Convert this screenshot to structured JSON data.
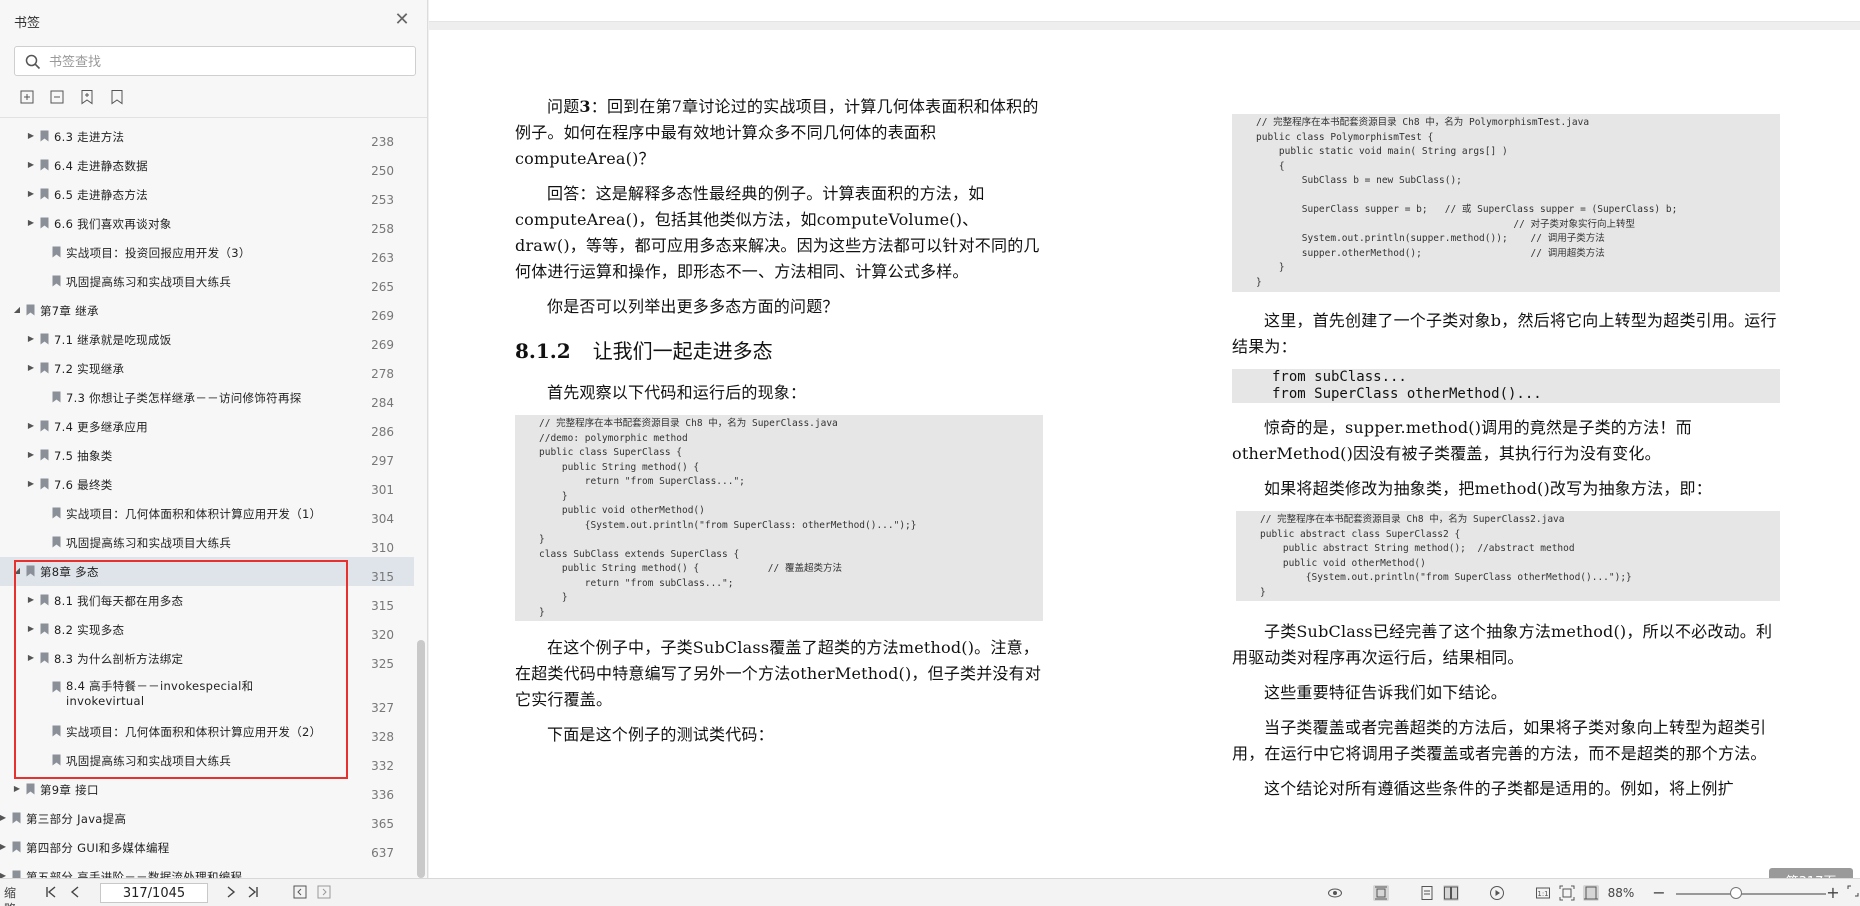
{
  "sidebar": {
    "title": "书签",
    "search_placeholder": "书签查找",
    "bookmarks": [
      {
        "label": "6.3  走进方法",
        "page": "238"
      },
      {
        "label": "6.4  走进静态数据",
        "page": "250"
      },
      {
        "label": "6.5  走进静态方法",
        "page": "253"
      },
      {
        "label": "6.6  我们喜欢再谈对象",
        "page": "258"
      },
      {
        "label": "实战项目：投资回报应用开发（3）",
        "page": "263"
      },
      {
        "label": "巩固提高练习和实战项目大练兵",
        "page": "265"
      },
      {
        "label": "第7章  继承",
        "page": "269"
      },
      {
        "label": "7.1  继承就是吃现成饭",
        "page": "269"
      },
      {
        "label": "7.2  实现继承",
        "page": "278"
      },
      {
        "label": "7.3  你想让子类怎样继承－－访问修饰符再探",
        "page": "284"
      },
      {
        "label": "7.4  更多继承应用",
        "page": "286"
      },
      {
        "label": "7.5  抽象类",
        "page": "297"
      },
      {
        "label": "7.6  最终类",
        "page": "301"
      },
      {
        "label": "实战项目：几何体面积和体积计算应用开发（1）",
        "page": "304"
      },
      {
        "label": "巩固提高练习和实战项目大练兵",
        "page": "310"
      },
      {
        "label": "第8章  多态",
        "page": "315"
      },
      {
        "label": "8.1  我们每天都在用多态",
        "page": "315"
      },
      {
        "label": "8.2  实现多态",
        "page": "320"
      },
      {
        "label": "8.3  为什么剖析方法绑定",
        "page": "325"
      },
      {
        "label": "8.4  高手特餐－－invokespecial和invokevirtual",
        "page": "327"
      },
      {
        "label": "实战项目：几何体面积和体积计算应用开发（2）",
        "page": "328"
      },
      {
        "label": "巩固提高练习和实战项目大练兵",
        "page": "332"
      },
      {
        "label": "第9章  接口",
        "page": "336"
      },
      {
        "label": "第三部分  Java提高",
        "page": "365"
      },
      {
        "label": "第四部分  GUI和多媒体编程",
        "page": "637"
      },
      {
        "label": "第五部分  高手进阶－－数据流处理和编程",
        "page": ""
      }
    ]
  },
  "document": {
    "left": {
      "p1_lead": "问题",
      "p1_num": "3",
      "p1_rest": "：回到在第7章讨论过的实战项目，计算几何体表面积和体积的例子。如何在程序中最有效地计算众多不同几何体的表面积computeArea()？",
      "p2": "回答：这是解释多态性最经典的例子。计算表面积的方法，如computeArea()，包括其他类似方法，如computeVolume()、draw()，等等，都可应用多态来解决。因为这些方法都可以针对不同的几何体进行运算和操作，即形态不一、方法相同、计算公式多样。",
      "p3": "你是否可以列举出更多多态方面的问题？",
      "h_num": "8.1.2",
      "h_title": "让我们一起走进多态",
      "p4": "首先观察以下代码和运行后的现象：",
      "code1": "// 完整程序在本书配套资源目录 Ch8 中，名为 SuperClass.java\n//demo: polymorphic method\npublic class SuperClass {\n    public String method() {\n        return \"from SuperClass...\";\n    }\n    public void otherMethod()\n        {System.out.println(\"from SuperClass: otherMethod()...\");}\n}\nclass SubClass extends SuperClass {\n    public String method() {            // 覆盖超类方法\n        return \"from subClass...\";\n    }\n}",
      "p5": "在这个例子中，子类SubClass覆盖了超类的方法method()。注意，在超类代码中特意编写了另外一个方法otherMethod()，但子类并没有对它实行覆盖。",
      "p6": "下面是这个例子的测试类代码："
    },
    "right": {
      "code2": "// 完整程序在本书配套资源目录 Ch8 中，名为 PolymorphismTest.java\npublic class PolymorphismTest {\n    public static void main( String args[] )\n    {\n        SubClass b = new SubClass();\n\n        SuperClass supper = b;   // 或 SuperClass supper = (SuperClass) b;\n                                             // 对子类对象实行向上转型\n        System.out.println(supper.method());    // 调用子类方法\n        supper.otherMethod();                   // 调用超类方法\n    }\n}",
      "p1": "这里，首先创建了一个子类对象b，然后将它向上转型为超类引用。运行结果为：",
      "output": "from subClass...\nfrom SuperClass otherMethod()...",
      "p2": "惊奇的是，supper.method()调用的竟然是子类的方法！而otherMethod()因没有被子类覆盖，其执行行为没有变化。",
      "p3": "如果将超类修改为抽象类，把method()改写为抽象方法，即：",
      "code3": "// 完整程序在本书配套资源目录 Ch8 中，名为 SuperClass2.java\npublic abstract class SuperClass2 {\n    public abstract String method();  //abstract method\n    public void otherMethod()\n        {System.out.println(\"from SuperClass otherMethod()...\");}\n}",
      "p4": "子类SubClass已经完善了这个抽象方法method()，所以不必改动。利用驱动类对程序再次运行后，结果相同。",
      "p5": "这些重要特征告诉我们如下结论。",
      "p6": "当子类覆盖或者完善超类的方法后，如果将子类对象向上转型为超类引用，在运行中它将调用子类覆盖或者完善的方法，而不是超类的那个方法。",
      "p7": "这个结论对所有遵循这些条件的子类都是适用的。例如，将上例扩"
    },
    "page_badge": "第317页"
  },
  "statusbar": {
    "left_label": "缩略",
    "page_value": "317/1045",
    "zoom": "88%"
  }
}
